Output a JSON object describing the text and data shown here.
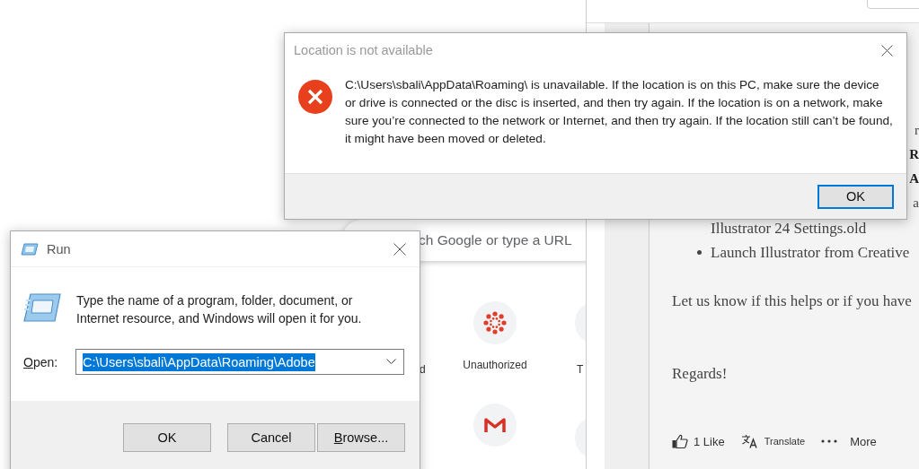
{
  "new_tab_page": {
    "search_box": {
      "placeholder": "ch Google or type a URL"
    },
    "shortcuts": [
      {
        "kind": "canvas",
        "label": "Unauthorized"
      },
      {
        "kind": "gmail"
      }
    ],
    "cut_labels": [
      "d",
      "T"
    ]
  },
  "forum_window": {
    "cut_line_ends": [
      {
        "text": "r",
        "bold": false
      },
      {
        "text": "R",
        "bold": true
      },
      {
        "text": "A",
        "bold": true
      },
      {
        "text": "a",
        "bold": false
      }
    ],
    "lines": [
      {
        "kind": "continuation",
        "text": "Illustrator 24 Settings.old"
      },
      {
        "kind": "bullet",
        "text": "Launch Illustrator from Creative"
      },
      {
        "kind": "paragraph",
        "text": "Let us know if this helps or if you have"
      },
      {
        "kind": "paragraph",
        "text": "Regards!"
      }
    ],
    "actions": [
      {
        "kind": "like",
        "label": "1 Like"
      },
      {
        "kind": "translate",
        "label": "Translate"
      },
      {
        "kind": "more",
        "label": "More"
      }
    ]
  },
  "error_dialog": {
    "title": "Location is not available",
    "message": "C:\\Users\\sbali\\AppData\\Roaming\\ is unavailable. If the location is on this PC, make sure the device or drive is connected or the disc is inserted, and then try again. If the location is on a network, make sure you’re connected to the network or Internet, and then try again. If the location still can’t be found, it might have been moved or deleted.",
    "buttons": [
      {
        "label": "OK",
        "default": true
      }
    ]
  },
  "run_dialog": {
    "title": "Run",
    "description": "Type the name of a program, folder, document, or Internet resource, and Windows will open it for you.",
    "open_label": "Open:",
    "open_label_underline_first": true,
    "open_value": "C:\\Users\\sbali\\AppData\\Roaming\\Adobe",
    "value_selected": true,
    "buttons": [
      {
        "label": "OK",
        "underline_first": false
      },
      {
        "label": "Cancel",
        "underline_first": false
      },
      {
        "label": "Browse...",
        "underline_first": true
      }
    ]
  }
}
